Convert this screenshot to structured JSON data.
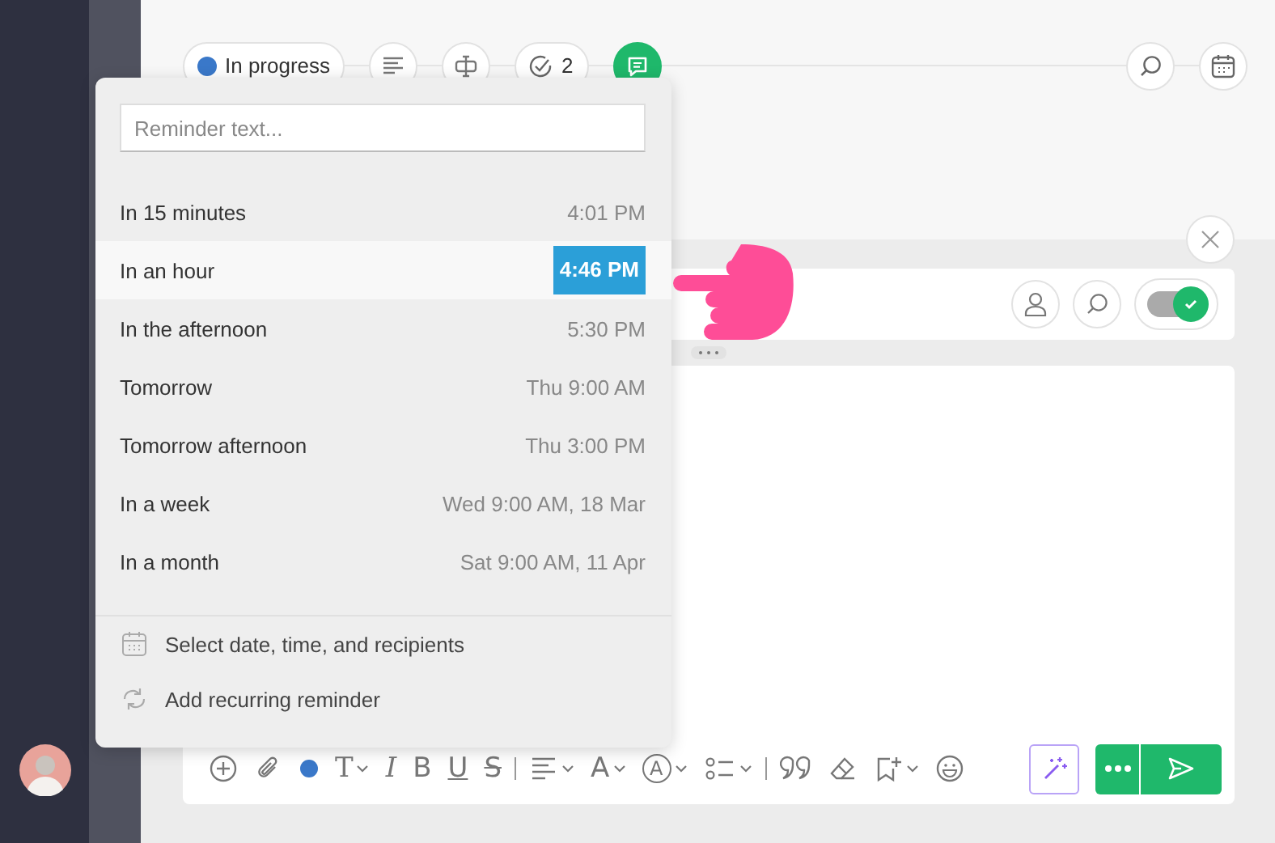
{
  "header": {
    "status": "In progress",
    "checklist_count": "2"
  },
  "reminder_popup": {
    "placeholder": "Reminder text...",
    "options": [
      {
        "label": "In 15 minutes",
        "time": "4:01 PM",
        "selected": false
      },
      {
        "label": "In an hour",
        "time": "4:46 PM",
        "selected": true
      },
      {
        "label": "In the afternoon",
        "time": "5:30 PM",
        "selected": false
      },
      {
        "label": "Tomorrow",
        "time": "Thu 9:00 AM",
        "selected": false
      },
      {
        "label": "Tomorrow afternoon",
        "time": "Thu 3:00 PM",
        "selected": false
      },
      {
        "label": "In a week",
        "time": "Wed 9:00 AM, 18 Mar",
        "selected": false
      },
      {
        "label": "In a month",
        "time": "Sat 9:00 AM, 11 Apr",
        "selected": false
      }
    ],
    "actions": [
      {
        "kind": "calendar",
        "label": "Select date, time, and recipients"
      },
      {
        "kind": "recurring",
        "label": "Add recurring reminder"
      }
    ]
  },
  "composer": {
    "toggle_on": true
  },
  "toolbar": [
    {
      "kind": "add"
    },
    {
      "kind": "attach"
    },
    {
      "kind": "color"
    },
    {
      "kind": "font",
      "label": "T"
    },
    {
      "kind": "italic",
      "label": "I"
    },
    {
      "kind": "bold",
      "label": "B"
    },
    {
      "kind": "underline",
      "label": "U"
    },
    {
      "kind": "strike",
      "label": "S"
    },
    {
      "kind": "sep"
    },
    {
      "kind": "align"
    },
    {
      "kind": "size",
      "label": "A"
    },
    {
      "kind": "circled",
      "label": "A"
    },
    {
      "kind": "list"
    },
    {
      "kind": "sep"
    },
    {
      "kind": "quote"
    },
    {
      "kind": "eraser"
    },
    {
      "kind": "bookmark"
    },
    {
      "kind": "emoji"
    }
  ]
}
